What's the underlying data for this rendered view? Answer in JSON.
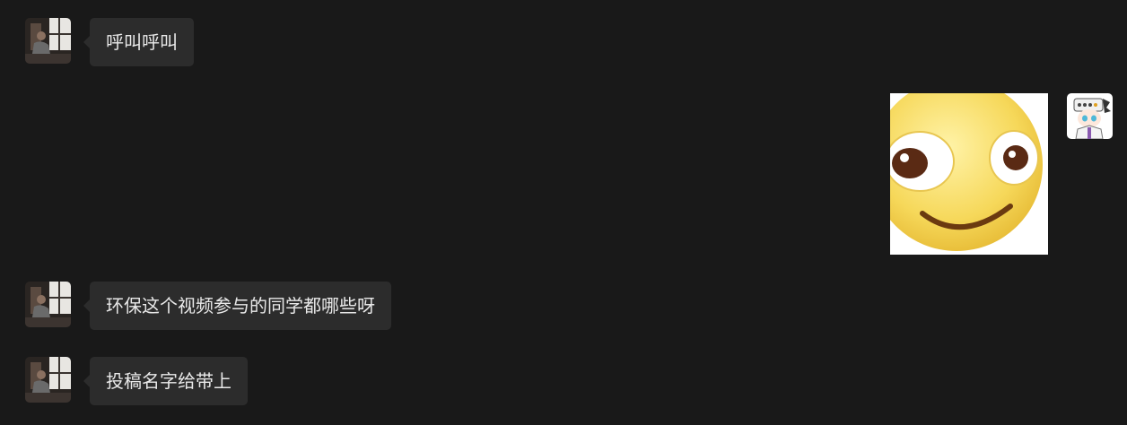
{
  "messages": [
    {
      "side": "left",
      "avatar": "photo-avatar",
      "text": "呼叫呼叫"
    },
    {
      "side": "right",
      "avatar": "anime-avatar",
      "sticker": "smiley-face-sticker"
    },
    {
      "side": "left",
      "avatar": "photo-avatar",
      "text": "环保这个视频参与的同学都哪些呀"
    },
    {
      "side": "left",
      "avatar": "photo-avatar",
      "text": "投稿名字给带上"
    }
  ],
  "colors": {
    "background": "#191919",
    "bubble": "#2c2c2c",
    "text": "#e9e9e9"
  }
}
